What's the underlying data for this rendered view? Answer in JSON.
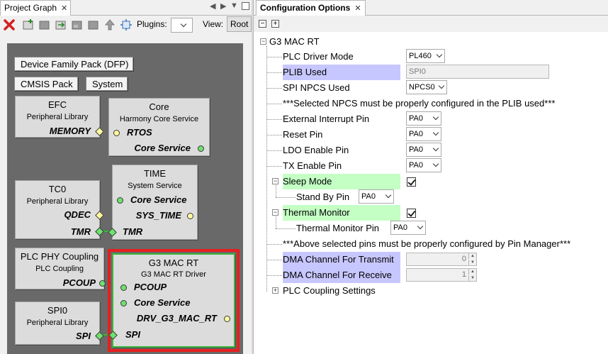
{
  "left_panel": {
    "tab_label": "Project Graph",
    "plugins_label": "Plugins:",
    "plugins_value": "",
    "view_label": "View:",
    "view_value": "Root",
    "buttons": {
      "dfp": "Device Family Pack (DFP)",
      "cmsis": "CMSIS Pack",
      "system": "System"
    },
    "components": {
      "efc": {
        "title": "EFC",
        "subtitle": "Peripheral Library",
        "ports": [
          "MEMORY"
        ]
      },
      "core": {
        "title": "Core",
        "subtitle": "Harmony Core Service",
        "ports": [
          "RTOS",
          "Core Service"
        ]
      },
      "tc0": {
        "title": "TC0",
        "subtitle": "Peripheral Library",
        "ports": [
          "QDEC",
          "TMR"
        ]
      },
      "time": {
        "title": "TIME",
        "subtitle": "System Service",
        "ports": [
          "Core Service",
          "SYS_TIME",
          "TMR"
        ]
      },
      "plc_phy": {
        "title": "PLC PHY Coupling",
        "subtitle": "PLC Coupling",
        "ports": [
          "PCOUP"
        ]
      },
      "g3mac": {
        "title": "G3 MAC RT",
        "subtitle": "G3 MAC RT Driver",
        "ports": [
          "PCOUP",
          "Core Service",
          "DRV_G3_MAC_RT",
          "SPI"
        ]
      },
      "spi0": {
        "title": "SPI0",
        "subtitle": "Peripheral Library",
        "ports": [
          "SPI"
        ]
      }
    }
  },
  "right_panel": {
    "tab_label": "Configuration Options",
    "root": "G3 MAC RT",
    "rows": {
      "plc_driver_mode": {
        "label": "PLC Driver Mode",
        "value": "PL460"
      },
      "plib_used": {
        "label": "PLIB Used",
        "value": "SPI0"
      },
      "spi_npcs_used": {
        "label": "SPI NPCS Used",
        "value": "NPCS0"
      },
      "npcs_note": {
        "label": "***Selected NPCS must be properly configured in the PLIB used***"
      },
      "ext_int_pin": {
        "label": "External Interrupt Pin",
        "value": "PA0"
      },
      "reset_pin": {
        "label": "Reset Pin",
        "value": "PA0"
      },
      "ldo_pin": {
        "label": "LDO Enable Pin",
        "value": "PA0"
      },
      "tx_pin": {
        "label": "TX Enable Pin",
        "value": "PA0"
      },
      "sleep_mode": {
        "label": "Sleep Mode",
        "checked": true
      },
      "standby_pin": {
        "label": "Stand By Pin",
        "value": "PA0"
      },
      "thermal_monitor": {
        "label": "Thermal Monitor",
        "checked": true
      },
      "thermal_pin": {
        "label": "Thermal Monitor Pin",
        "value": "PA0"
      },
      "pins_note": {
        "label": "***Above selected pins must be properly configured by Pin Manager***"
      },
      "dma_tx": {
        "label": "DMA Channel For Transmit",
        "value": "0"
      },
      "dma_rx": {
        "label": "DMA Channel For Receive",
        "value": "1"
      },
      "plc_coupling": {
        "label": "PLC Coupling Settings"
      }
    }
  },
  "colors": {
    "canvas": "#696969",
    "selection_border": "#e81e1e",
    "component_active_border": "#3cb43c",
    "highlight_blue": "#c7c7ff",
    "highlight_green": "#c4ffc4",
    "delete_icon": "#d42020"
  },
  "icons": [
    "delete-icon",
    "add-component-icon",
    "component-icon",
    "export-icon",
    "group-icon",
    "move-up-icon",
    "auto-arrange-icon",
    "dropdown-icon",
    "nav-left-icon",
    "nav-right-icon",
    "menu-icon",
    "close-icon",
    "collapse-icon",
    "expand-icon",
    "checkbox-icon"
  ]
}
